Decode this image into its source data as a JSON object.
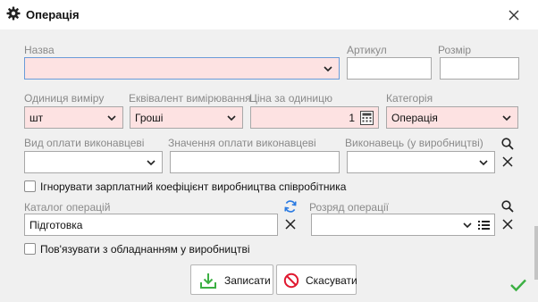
{
  "window": {
    "title": "Операція",
    "icon": "gear-icon",
    "close_icon": "close-icon"
  },
  "fields": {
    "name": {
      "label": "Назва",
      "value": ""
    },
    "article": {
      "label": "Артикул",
      "value": ""
    },
    "size": {
      "label": "Розмір",
      "value": ""
    },
    "unit": {
      "label": "Одиниця виміру",
      "value": "шт"
    },
    "equivalent": {
      "label": "Еквівалент вимірювання",
      "value": "Гроші"
    },
    "price": {
      "label": "Ціна за одиницю",
      "value": "1"
    },
    "category": {
      "label": "Категорія",
      "value": "Операція"
    },
    "payment_type": {
      "label": "Вид оплати виконавцеві",
      "value": ""
    },
    "payment_value": {
      "label": "Значення оплати виконавцеві",
      "value": ""
    },
    "executor": {
      "label": "Виконавець (у виробництві)",
      "value": ""
    },
    "catalog": {
      "label": "Каталог операцій",
      "value": "Підготовка"
    },
    "grade": {
      "label": "Розряд операції",
      "value": ""
    }
  },
  "checkboxes": {
    "ignore_coef": {
      "label": "Ігнорувати зарплатний коефіцієнт виробництва співробітника",
      "checked": false
    },
    "link_equipment": {
      "label": "Пов'язувати з обладнанням у виробництві",
      "checked": false
    }
  },
  "buttons": {
    "save": "Записати",
    "cancel": "Скасувати"
  },
  "colors": {
    "required_bg": "#fde2e2",
    "accent": "#2a7ae2",
    "ok_green": "#3cb043",
    "cancel_red": "#e0182f"
  }
}
